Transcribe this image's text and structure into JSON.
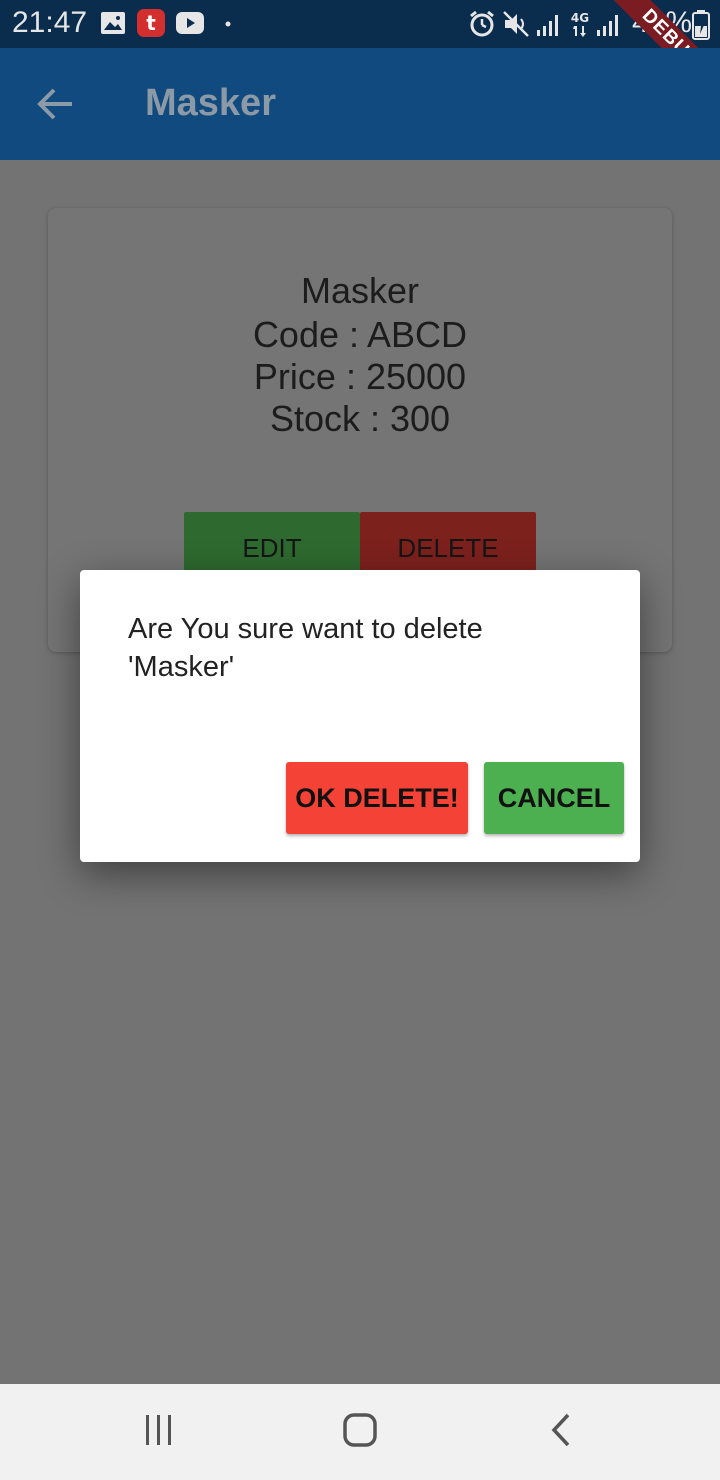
{
  "status_bar": {
    "time": "21:47",
    "battery": "43%",
    "icons": [
      "image-icon",
      "app-notification-icon",
      "youtube-icon",
      "dot-icon",
      "alarm-icon",
      "mute-icon",
      "signal-icon",
      "4g-icon",
      "signal-icon",
      "battery-icon"
    ]
  },
  "debug_label": "DEBUG",
  "app_bar": {
    "title": "Masker",
    "back_icon": "arrow-left-icon"
  },
  "product": {
    "name": "Masker",
    "code_line": "Code : ABCD",
    "price_line": "Price : 25000",
    "stock_line": "Stock : 300",
    "edit_label": "EDIT",
    "delete_label": "DELETE"
  },
  "dialog": {
    "message_line1": "Are You sure want to delete",
    "message_line2": "'Masker'",
    "ok_label": "OK DELETE!",
    "cancel_label": "CANCEL"
  },
  "nav_bar": {
    "icons": [
      "recent-apps-icon",
      "home-icon",
      "back-icon"
    ]
  },
  "colors": {
    "app_bar": "#104a7e",
    "status_bar": "#0a2c4d",
    "ok_button": "#f44336",
    "cancel_button": "#4caf50",
    "edit_button": "#2e6a2f",
    "delete_button": "#7d211d",
    "scrim": "#737373"
  }
}
